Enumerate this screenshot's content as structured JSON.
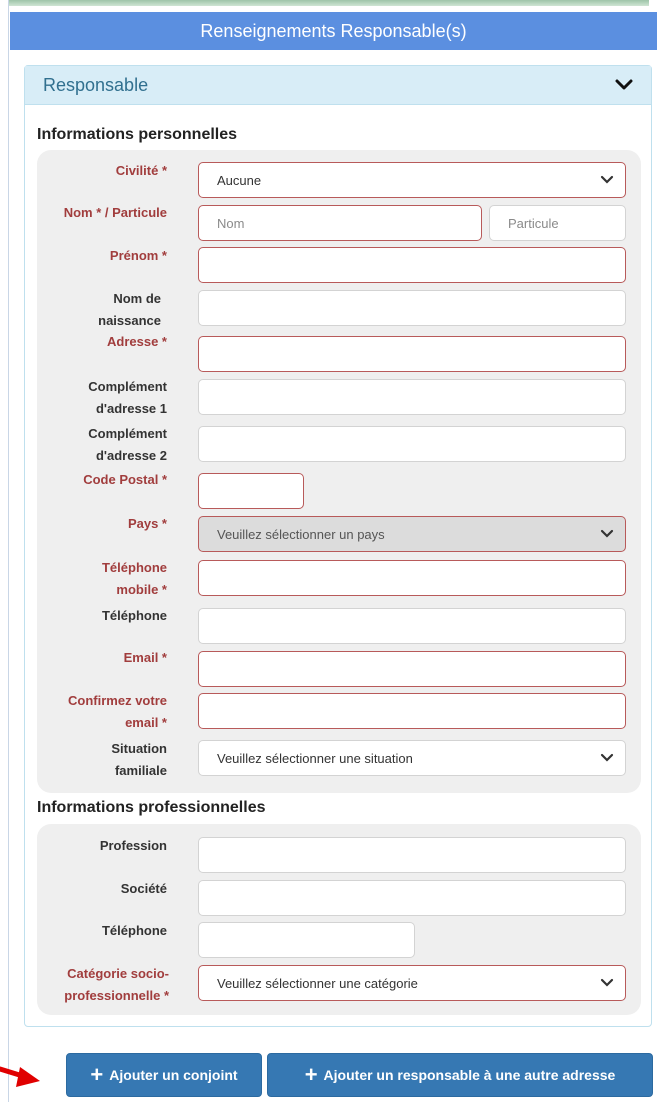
{
  "header": {
    "title": "Renseignements Responsable(s)"
  },
  "panel": {
    "title": "Responsable",
    "toggle_icon": "chevron-down-icon"
  },
  "personal": {
    "title": "Informations personnelles",
    "civilite": {
      "label": "Civilité *",
      "value": "Aucune"
    },
    "nom": {
      "label": "Nom * / Particule",
      "placeholder_nom": "Nom",
      "placeholder_particule": "Particule"
    },
    "prenom": {
      "label": "Prénom *"
    },
    "nom_naissance": {
      "label": "Nom de naissance"
    },
    "adresse": {
      "label": "Adresse *"
    },
    "complement1": {
      "label": "Complément d'adresse 1"
    },
    "complement2": {
      "label": "Complément d'adresse 2"
    },
    "code_postal": {
      "label": "Code Postal *"
    },
    "pays": {
      "label": "Pays *",
      "value": "Veuillez sélectionner un pays"
    },
    "tel_mobile": {
      "label": "Téléphone mobile *"
    },
    "telephone": {
      "label": "Téléphone"
    },
    "email": {
      "label": "Email *"
    },
    "confirm_email": {
      "label": "Confirmez votre email *"
    },
    "situation": {
      "label": "Situation familiale",
      "value": "Veuillez sélectionner une situation"
    }
  },
  "professional": {
    "title": "Informations professionnelles",
    "profession": {
      "label": "Profession"
    },
    "societe": {
      "label": "Société"
    },
    "telephone": {
      "label": "Téléphone"
    },
    "categorie": {
      "label": "Catégorie socio-professionnelle *",
      "value": "Veuillez sélectionner une catégorie"
    }
  },
  "actions": {
    "add_spouse": "Ajouter un conjoint",
    "add_other_responsible": "Ajouter un responsable à une autre adresse"
  },
  "colors": {
    "header_bg": "#5b8fe0",
    "panel_header_bg": "#d8edf7",
    "required_label": "#a13d3d",
    "button_bg": "#3678b3",
    "arrow": "#e00000"
  }
}
